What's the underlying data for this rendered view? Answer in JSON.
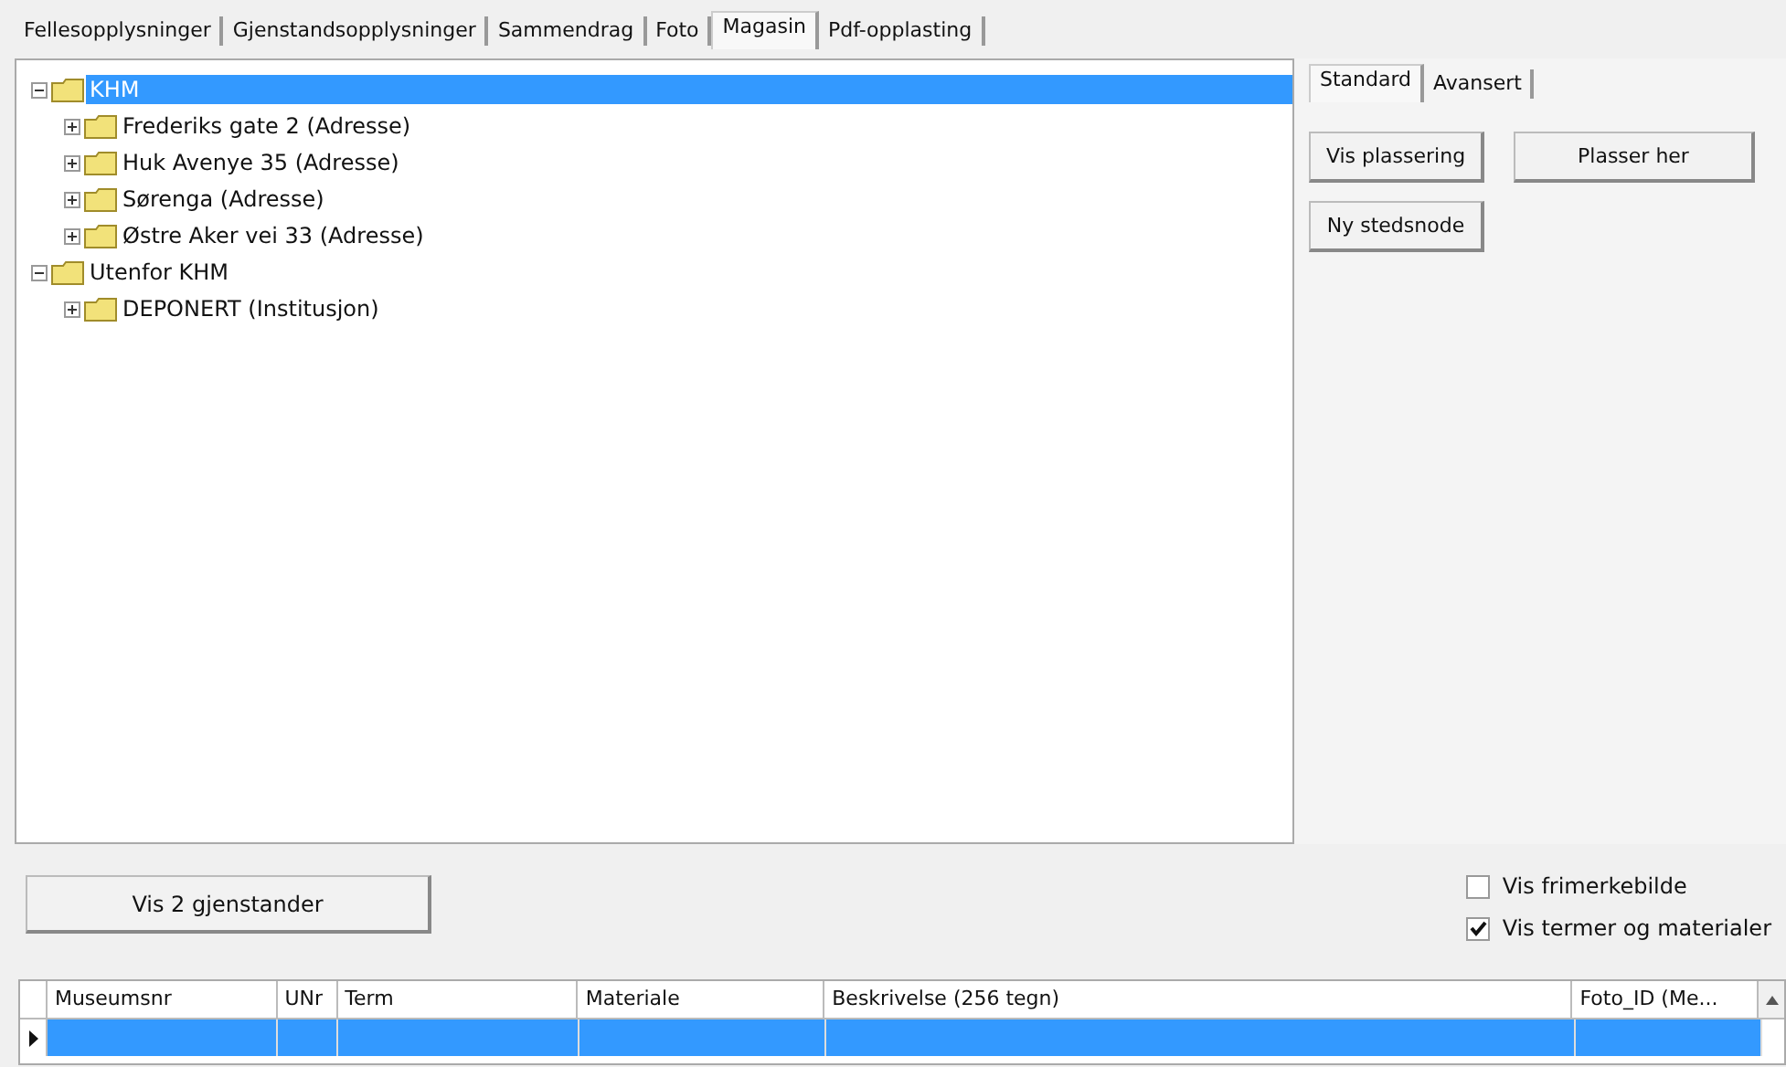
{
  "tabs": [
    {
      "label": "Fellesopplysninger",
      "selected": false
    },
    {
      "label": "Gjenstandsopplysninger",
      "selected": false
    },
    {
      "label": "Sammendrag",
      "selected": false
    },
    {
      "label": "Foto",
      "selected": false
    },
    {
      "label": "Magasin",
      "selected": true
    },
    {
      "label": "Pdf-opplasting",
      "selected": false
    }
  ],
  "tree": [
    {
      "label": "KHM",
      "expanded": true,
      "selected": true,
      "children": [
        {
          "label": "Frederiks gate 2 (Adresse)",
          "expanded": false,
          "selected": false
        },
        {
          "label": "Huk Avenye 35 (Adresse)",
          "expanded": false,
          "selected": false
        },
        {
          "label": "Sørenga (Adresse)",
          "expanded": false,
          "selected": false
        },
        {
          "label": "Østre Aker vei 33 (Adresse)",
          "expanded": false,
          "selected": false
        }
      ]
    },
    {
      "label": "Utenfor KHM",
      "expanded": true,
      "selected": false,
      "children": [
        {
          "label": "DEPONERT (Institusjon)",
          "expanded": false,
          "selected": false
        }
      ]
    }
  ],
  "side_tabs": [
    {
      "label": "Standard",
      "selected": true
    },
    {
      "label": "Avansert",
      "selected": false
    }
  ],
  "side_buttons": [
    "Vis plassering",
    "Plasser her",
    "Ny stedsnode"
  ],
  "show_button": "Vis 2 gjenstander",
  "options": [
    {
      "label": "Vis frimerkebilde",
      "checked": false
    },
    {
      "label": "Vis termer og materialer",
      "checked": true
    }
  ],
  "grid": {
    "columns": [
      "Museumsnr",
      "UNr",
      "Term",
      "Materiale",
      "Beskrivelse (256 tegn)",
      "Foto_ID (Me..."
    ],
    "rows": [
      {
        "selected": true
      }
    ]
  }
}
